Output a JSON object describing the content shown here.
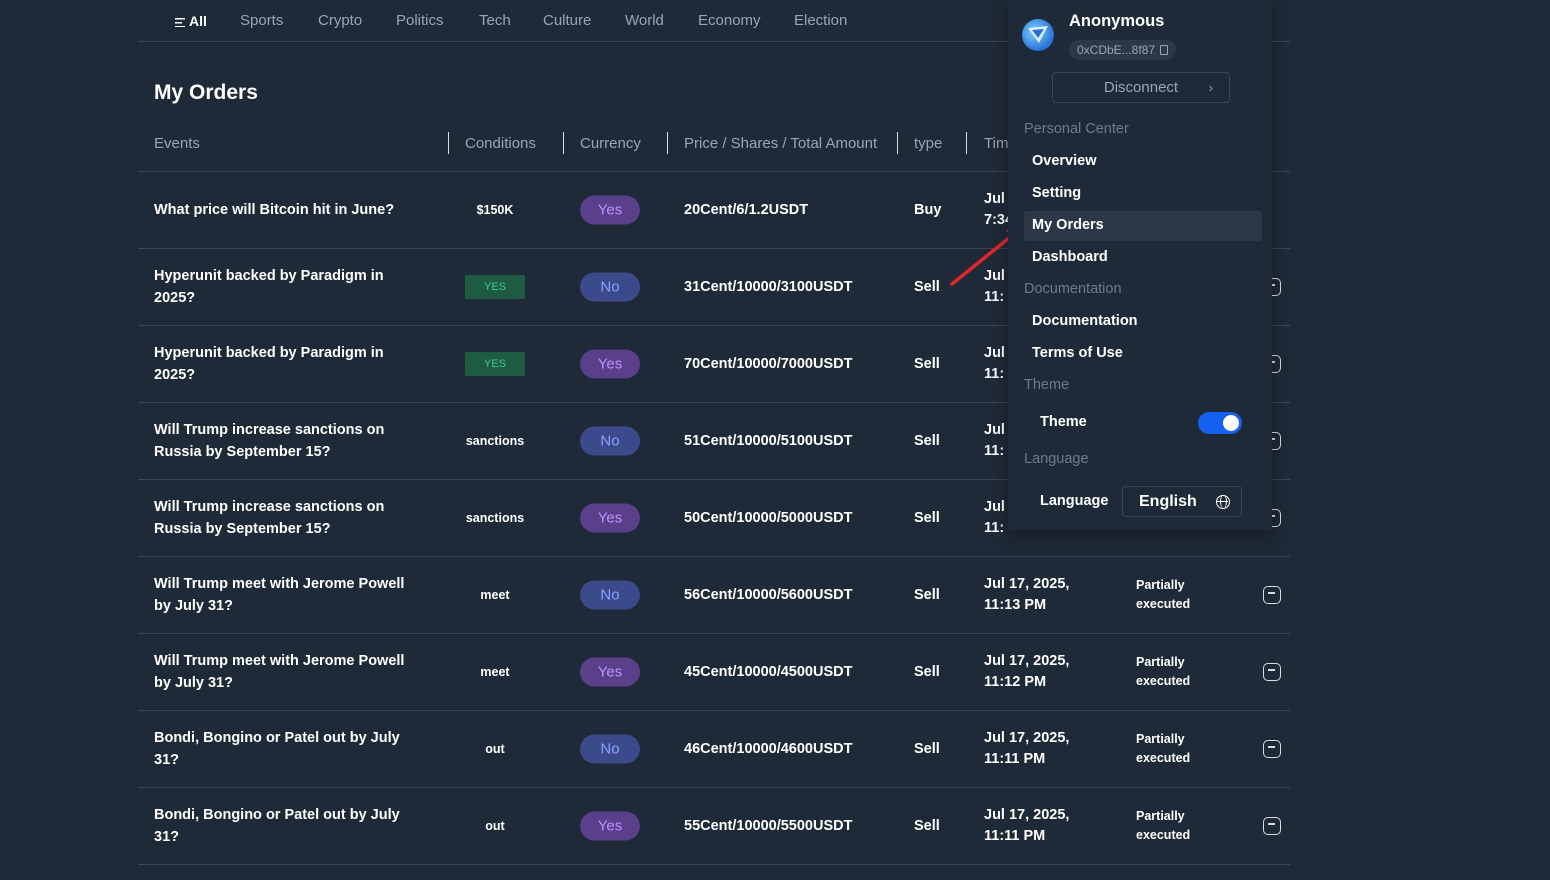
{
  "nav": {
    "tabs": [
      {
        "label": "All"
      },
      {
        "label": "Sports"
      },
      {
        "label": "Crypto"
      },
      {
        "label": "Politics"
      },
      {
        "label": "Tech"
      },
      {
        "label": "Culture"
      },
      {
        "label": "World"
      },
      {
        "label": "Economy"
      },
      {
        "label": "Election"
      }
    ]
  },
  "page_title": "My Orders",
  "table": {
    "headers": {
      "events": "Events",
      "conditions": "Conditions",
      "currency": "Currency",
      "price": "Price / Shares / Total Amount",
      "type": "type",
      "time": "Tim"
    },
    "rows": [
      {
        "event": "What price will Bitcoin hit in June?",
        "condition": "$150K",
        "currency": "Yes",
        "price": "20Cent/6/1.2USDT",
        "type": "Buy",
        "time": "Jul 1",
        "time2": "7:34",
        "status": "",
        "status2": ""
      },
      {
        "event": "Hyperunit backed by Paradigm in 2025?",
        "condition": "YES",
        "currency": "No",
        "price": "31Cent/10000/3100USDT",
        "type": "Sell",
        "time": "Jul",
        "time2": "11:",
        "status": "",
        "status2": ""
      },
      {
        "event": "Hyperunit backed by Paradigm in 2025?",
        "condition": "YES",
        "currency": "Yes",
        "price": "70Cent/10000/7000USDT",
        "type": "Sell",
        "time": "Jul",
        "time2": "11:",
        "status": "",
        "status2": ""
      },
      {
        "event": "Will Trump increase sanctions on Russia by September 15?",
        "condition": "sanctions",
        "currency": "No",
        "price": "51Cent/10000/5100USDT",
        "type": "Sell",
        "time": "Jul",
        "time2": "11:",
        "status": "",
        "status2": ""
      },
      {
        "event": "Will Trump increase sanctions on Russia by September 15?",
        "condition": "sanctions",
        "currency": "Yes",
        "price": "50Cent/10000/5000USDT",
        "type": "Sell",
        "time": "Jul",
        "time2": "11:",
        "status": "",
        "status2": ""
      },
      {
        "event": "Will Trump meet with Jerome Powell by July 31?",
        "condition": "meet",
        "currency": "No",
        "price": "56Cent/10000/5600USDT",
        "type": "Sell",
        "time": "Jul 17, 2025,",
        "time2": "11:13 PM",
        "status": "Partially",
        "status2": "executed"
      },
      {
        "event": "Will Trump meet with Jerome Powell by July 31?",
        "condition": "meet",
        "currency": "Yes",
        "price": "45Cent/10000/4500USDT",
        "type": "Sell",
        "time": "Jul 17, 2025,",
        "time2": "11:12 PM",
        "status": "Partially",
        "status2": "executed"
      },
      {
        "event": "Bondi, Bongino or Patel out by July 31?",
        "condition": "out",
        "currency": "No",
        "price": "46Cent/10000/4600USDT",
        "type": "Sell",
        "time": "Jul 17, 2025,",
        "time2": "11:11 PM",
        "status": "Partially",
        "status2": "executed"
      },
      {
        "event": "Bondi, Bongino or Patel out by July 31?",
        "condition": "out",
        "currency": "Yes",
        "price": "55Cent/10000/5500USDT",
        "type": "Sell",
        "time": "Jul 17, 2025,",
        "time2": "11:11 PM",
        "status": "Partially",
        "status2": "executed"
      }
    ]
  },
  "panel": {
    "username": "Anonymous",
    "address": "0xCDbE...8f87",
    "disconnect": "Disconnect",
    "sections": {
      "personal": "Personal Center",
      "documentation": "Documentation",
      "theme": "Theme",
      "language": "Language"
    },
    "personal_items": [
      "Overview",
      "Setting",
      "My Orders",
      "Dashboard"
    ],
    "doc_items": [
      "Documentation",
      "Terms of Use"
    ],
    "theme_label": "Theme",
    "theme_on": true,
    "language_label": "Language",
    "language_value": "English"
  },
  "colors": {
    "background": "#1f2a38",
    "yes_pill": "#5a3f8a",
    "no_pill": "#3b4a8a",
    "yes_badge": "#1f5a43",
    "toggle": "#1560f0",
    "arrow": "#e0262b"
  }
}
